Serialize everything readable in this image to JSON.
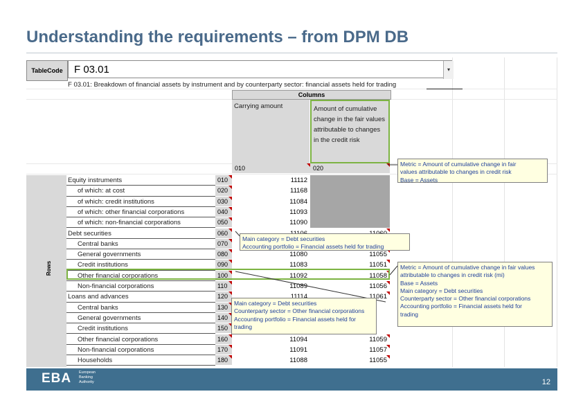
{
  "title": "Understanding the requirements – from DPM DB",
  "table_code": {
    "label": "TableCode",
    "value": "F 03.01",
    "dropdown": "▾"
  },
  "subtitle": "F 03.01: Breakdown of financial assets by instrument and by counterparty sector: financial assets held for trading",
  "columns_header": "Columns",
  "col_headers": [
    {
      "label": "Carrying amount",
      "code": "010"
    },
    {
      "label": "Amount of cumulative change in the fair values attributable to changes in the credit risk",
      "code": "020"
    }
  ],
  "row_header": "Rows",
  "rows": [
    {
      "label": "Equity instruments",
      "code": "010",
      "v1": "11112",
      "v2": "",
      "indent": false
    },
    {
      "label": "of which: at cost",
      "code": "020",
      "v1": "11168",
      "v2": "",
      "indent": true
    },
    {
      "label": "of which: credit institutions",
      "code": "030",
      "v1": "11084",
      "v2": "",
      "indent": true
    },
    {
      "label": "of which: other financial corporations",
      "code": "040",
      "v1": "11093",
      "v2": "",
      "indent": true
    },
    {
      "label": "of which: non-financial corporations",
      "code": "050",
      "v1": "11090",
      "v2": "",
      "indent": true
    },
    {
      "label": "Debt securities",
      "code": "060",
      "v1": "11106",
      "v2": "11060",
      "indent": false
    },
    {
      "label": "Central banks",
      "code": "070",
      "v1": "",
      "v2": "",
      "indent": true
    },
    {
      "label": "General governments",
      "code": "080",
      "v1": "11080",
      "v2": "11055",
      "indent": true
    },
    {
      "label": "Credit institutions",
      "code": "090",
      "v1": "11083",
      "v2": "11051",
      "indent": true
    },
    {
      "label": "Other financial corporations",
      "code": "100",
      "v1": "11092",
      "v2": "11058",
      "indent": true
    },
    {
      "label": "Non-financial corporations",
      "code": "110",
      "v1": "11089",
      "v2": "11056",
      "indent": true
    },
    {
      "label": "Loans and advances",
      "code": "120",
      "v1": "11114",
      "v2": "11061",
      "indent": false
    },
    {
      "label": "Central banks",
      "code": "130",
      "v1": "",
      "v2": "",
      "indent": true
    },
    {
      "label": "General governments",
      "code": "140",
      "v1": "",
      "v2": "",
      "indent": true
    },
    {
      "label": "Credit institutions",
      "code": "150",
      "v1": "",
      "v2": "",
      "indent": true
    },
    {
      "label": "Other financial corporations",
      "code": "160",
      "v1": "11094",
      "v2": "11059",
      "indent": true
    },
    {
      "label": "Non-financial corporations",
      "code": "170",
      "v1": "11091",
      "v2": "11057",
      "indent": true
    },
    {
      "label": "Households",
      "code": "180",
      "v1": "11088",
      "v2": "11055",
      "indent": true
    }
  ],
  "notes": {
    "col020": [
      "Metric = Amount of cumulative change in fair",
      "values attributable to changes in credit risk",
      "Base = Assets"
    ],
    "row060": [
      "Main category = Debt securities",
      "Accounting portfolio = Financial assets held for trading"
    ],
    "cell100_020": [
      "Metric = Amount of cumulative change in fair values",
      "attributable to changes in credit risk (mi)",
      "Base = Assets",
      "Main category = Debt securities",
      "Counterparty sector = Other financial corporations",
      "Accounting portfolio = Financial assets held for",
      "trading"
    ],
    "row100": [
      "Main category = Debt securities",
      "Counterparty sector = Other financial corporations",
      "Accounting portfolio = Financial assets held for",
      "trading"
    ]
  },
  "footer": {
    "logo": "EBA",
    "org_lines": [
      "European",
      "Banking",
      "Authority"
    ],
    "page": "12"
  },
  "colors": {
    "title": "#4a6a8a",
    "footer": "#3f6f8f",
    "note_bg": "#ffffe1",
    "note_text": "#1f3f9a",
    "highlight": "#7cb342"
  }
}
